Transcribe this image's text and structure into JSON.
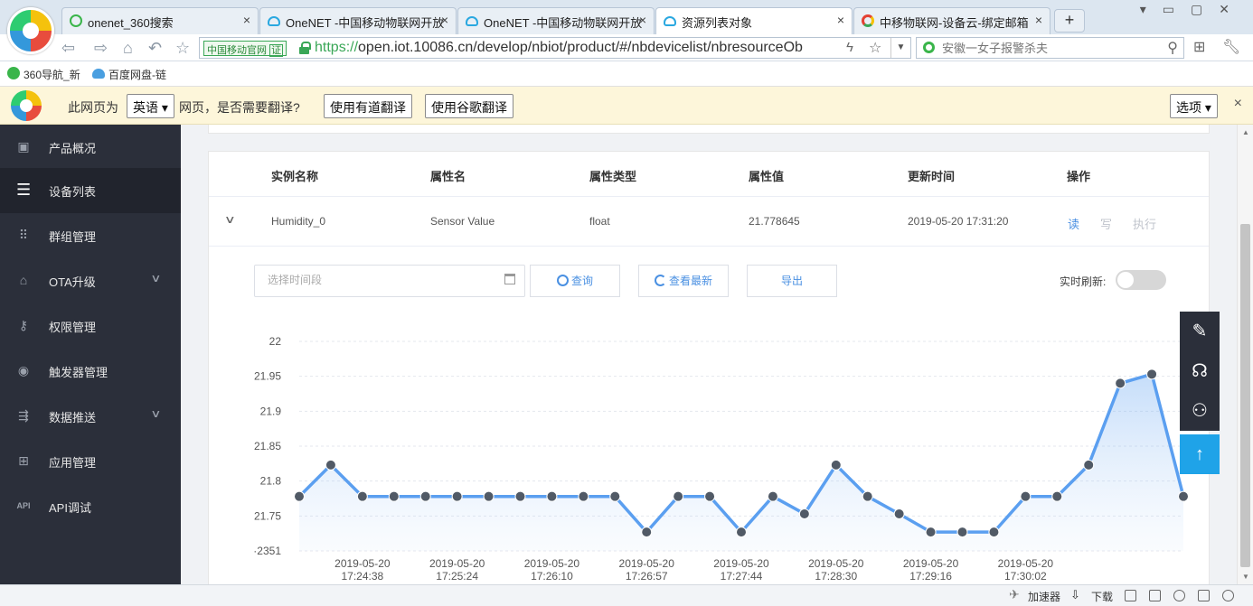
{
  "browser": {
    "tabs": [
      {
        "title": "onenet_360搜索",
        "icon": "search-q-icon"
      },
      {
        "title": "OneNET -中国移动物联网开放",
        "icon": "cloud-icon"
      },
      {
        "title": "OneNET -中国移动物联网开放",
        "icon": "cloud-icon"
      },
      {
        "title": "资源列表对象",
        "icon": "cloud-icon"
      },
      {
        "title": "中移物联网-设备云-绑定邮箱",
        "icon": "chrome-icon"
      }
    ],
    "tab_close": "×",
    "new_tab": "+",
    "trust_badge": "中国移动官网",
    "trust_mark": "证",
    "url_scheme": "https://",
    "url_rest": "open.iot.10086.cn/develop/nbiot/product/#/nbdevicelist/nbresourceOb",
    "search_placeholder": "安徽一女子报警杀夫",
    "bookmarks": [
      "360导航_新",
      "百度网盘-链"
    ]
  },
  "translate_bar": {
    "prefix": "此网页为",
    "language": "英语 ▾",
    "question": "网页，是否需要翻译?",
    "youdao_button": "使用有道翻译",
    "google_button": "使用谷歌翻译",
    "options": "选项 ▾",
    "close": "×"
  },
  "sidebar": {
    "items": [
      {
        "label": "产品概况",
        "icon": "box-icon",
        "active": false,
        "expandable": false
      },
      {
        "label": "设备列表",
        "icon": "list-icon",
        "active": true,
        "expandable": false
      },
      {
        "label": "群组管理",
        "icon": "grid-dots-icon",
        "active": false,
        "expandable": false
      },
      {
        "label": "OTA升级",
        "icon": "upload-icon",
        "active": false,
        "expandable": true
      },
      {
        "label": "权限管理",
        "icon": "key-icon",
        "active": false,
        "expandable": false
      },
      {
        "label": "触发器管理",
        "icon": "trigger-icon",
        "active": false,
        "expandable": false
      },
      {
        "label": "数据推送",
        "icon": "push-icon",
        "active": false,
        "expandable": true
      },
      {
        "label": "应用管理",
        "icon": "apps-icon",
        "active": false,
        "expandable": false
      },
      {
        "label": "API调试",
        "icon": "api-icon",
        "active": false,
        "expandable": false
      }
    ]
  },
  "table": {
    "headers": [
      "实例名称",
      "属性名",
      "属性类型",
      "属性值",
      "更新时间",
      "操作"
    ],
    "row": {
      "instance": "Humidity_0",
      "attribute": "Sensor Value",
      "type": "float",
      "value": "21.778645",
      "updated": "2019-05-20 17:31:20",
      "actions": [
        "读",
        "写",
        "执行"
      ]
    }
  },
  "toolbar": {
    "date_placeholder": "选择时间段",
    "query_button": "查询",
    "latest_button": "查看最新",
    "export_button": "导出",
    "realtime_label": "实时刷新:",
    "realtime_on": false
  },
  "chart_data": {
    "type": "area",
    "yticks": [
      "22",
      "21.95",
      "21.9",
      "21.85",
      "21.8",
      "21.75",
      "·2351"
    ],
    "ylim": [
      21.7,
      22
    ],
    "x_labels": [
      [
        "2019-05-20",
        "17:24:38"
      ],
      [
        "2019-05-20",
        "17:25:24"
      ],
      [
        "2019-05-20",
        "17:26:10"
      ],
      [
        "2019-05-20",
        "17:26:57"
      ],
      [
        "2019-05-20",
        "17:27:44"
      ],
      [
        "2019-05-20",
        "17:28:30"
      ],
      [
        "2019-05-20",
        "17:29:16"
      ],
      [
        "2019-05-20",
        "17:30:02"
      ]
    ],
    "values": [
      21.778,
      21.823,
      21.778,
      21.778,
      21.778,
      21.778,
      21.778,
      21.778,
      21.778,
      21.778,
      21.778,
      21.727,
      21.778,
      21.778,
      21.727,
      21.778,
      21.753,
      21.823,
      21.778,
      21.753,
      21.727,
      21.727,
      21.727,
      21.778,
      21.778,
      21.823,
      21.94,
      21.953,
      21.778
    ],
    "line_color": "#5b9ff0",
    "fill_color": "#dbe9fb",
    "grid": true
  },
  "float_tools": [
    "edit-icon",
    "headset-icon",
    "add-user-icon",
    "back-to-top-icon"
  ],
  "statusbar": {
    "accelerator": "加速器",
    "download": "下载"
  }
}
